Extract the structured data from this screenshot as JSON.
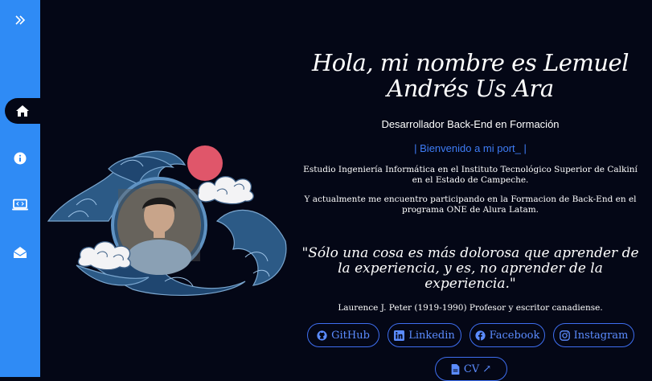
{
  "sidebar": {
    "items": [
      {
        "icon": "double-chevron-right-icon"
      },
      {
        "icon": "home-icon",
        "active": true
      },
      {
        "icon": "info-icon"
      },
      {
        "icon": "code-laptop-icon"
      },
      {
        "icon": "envelope-open-icon"
      }
    ]
  },
  "hero": {
    "title": "Hola, mi nombre es Lemuel Andrés Us Ara",
    "subtitle": "Desarrollador Back-End en Formación",
    "typing_text": "| Bienvenido a mi port_ |",
    "paragraph_1": "Estudio Ingeniería Informática en el Instituto Tecnológico Superior de Calkiní en el Estado de Campeche.",
    "paragraph_2": "Y actualmente me encuentro participando en la Formacion de Back-End en el programa ONE de Alura Latam."
  },
  "quote": {
    "text": "\"Sólo una cosa es más dolorosa que aprender de la experiencia, y es, no aprender de la experiencia.\"",
    "author": "Laurence J. Peter (1919-1990) Profesor y escritor canadiense."
  },
  "links": {
    "github": "GitHub",
    "linkedin": "Linkedin",
    "facebook": "Facebook",
    "instagram": "Instagram",
    "cv": "CV ↗"
  },
  "colors": {
    "sidebar": "#2f8bf5",
    "background": "#040716",
    "accent": "#3e6ef0"
  }
}
